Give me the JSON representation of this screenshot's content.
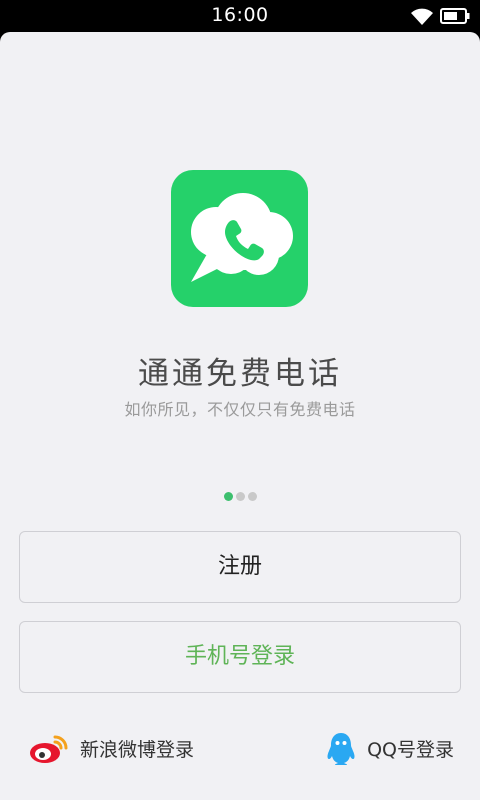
{
  "status_bar": {
    "time": "16:00",
    "wifi_icon": "wifi-icon",
    "battery_icon": "battery-icon"
  },
  "app": {
    "icon": "cloud-phone-icon",
    "icon_color": "#25d16a",
    "title": "通通免费电话",
    "subtitle": "如你所见，不仅仅只有免费电话"
  },
  "pager": {
    "total": 3,
    "active_index": 0,
    "active_color": "#3dbf6e"
  },
  "buttons": {
    "register_label": "注册",
    "phone_login_label": "手机号登录",
    "phone_login_color": "#5fb457"
  },
  "social_login": {
    "weibo_label": "新浪微博登录",
    "weibo_icon": "weibo-icon",
    "qq_label": "QQ号登录",
    "qq_icon": "qq-icon"
  }
}
